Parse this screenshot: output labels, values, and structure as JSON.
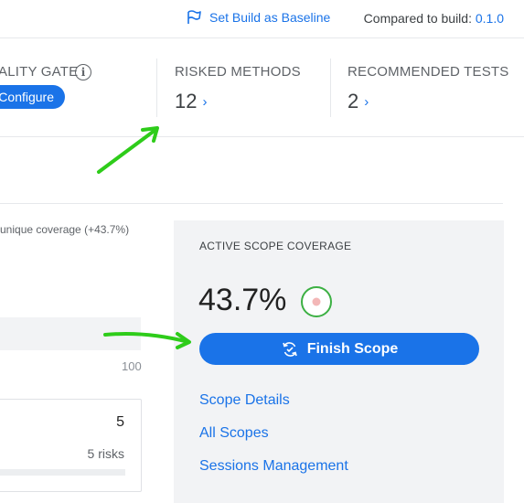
{
  "header": {
    "baseline_label": "Set Build as Baseline",
    "compared_label": "Compared to build:",
    "compared_build": "0.1.0"
  },
  "metrics": {
    "quality_gate": {
      "title": "ALITY GATE",
      "configure_label": "Configure"
    },
    "risked_methods": {
      "title": "RISKED METHODS",
      "value": "12",
      "chevron": "›"
    },
    "recommended_tests": {
      "title": "RECOMMENDED TESTS",
      "value": "2",
      "chevron": "›"
    }
  },
  "coverage": {
    "unique_label": "unique coverage (+43.7%)",
    "bar_max": "100"
  },
  "risk_card": {
    "count": "5",
    "label": "5 risks"
  },
  "scope": {
    "title": "ACTIVE SCOPE COVERAGE",
    "percentage": "43.7%",
    "finish_label": "Finish Scope",
    "links": [
      "Scope Details",
      "All Scopes",
      "Sessions Management"
    ]
  },
  "colors": {
    "accent": "#1a73e8",
    "annotation": "#2ecc1a",
    "ring": "#3cb043",
    "ring_dot": "#f3b7b7",
    "panel_bg": "#f2f3f5"
  },
  "icons": {
    "baseline": "flag-icon",
    "info": "info-icon",
    "finish": "refresh-icon",
    "status": "status-ring-icon"
  }
}
